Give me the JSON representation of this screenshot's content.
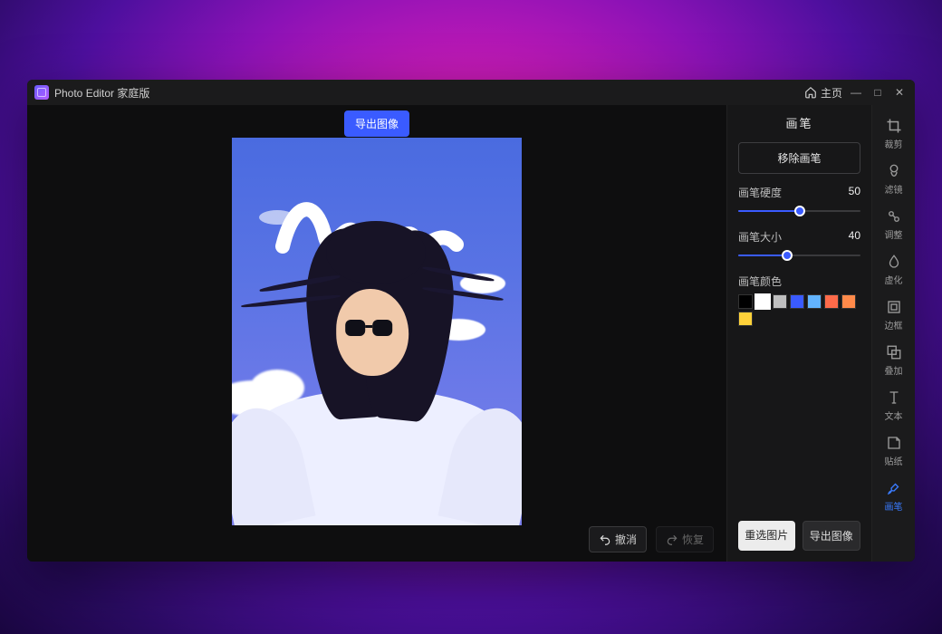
{
  "app": {
    "title": "Photo Editor 家庭版"
  },
  "titlebar": {
    "home": "主页"
  },
  "canvas": {
    "export_top": "导出图像",
    "undo": "撤消",
    "redo": "恢复"
  },
  "panel": {
    "title": "画笔",
    "remove": "移除画笔",
    "hardness": {
      "label": "画笔硬度",
      "value": 50,
      "min": 0,
      "max": 100
    },
    "size": {
      "label": "画笔大小",
      "value": 40,
      "min": 0,
      "max": 100
    },
    "color_label": "画笔颜色",
    "colors": [
      {
        "hex": "#000000",
        "selected": false
      },
      {
        "hex": "#ffffff",
        "selected": true
      },
      {
        "hex": "#bfbfbf",
        "selected": false
      },
      {
        "hex": "#3a5bff",
        "selected": false
      },
      {
        "hex": "#63b4ff",
        "selected": false
      },
      {
        "hex": "#ff6b4a",
        "selected": false
      },
      {
        "hex": "#ff8a4a",
        "selected": false
      },
      {
        "hex": "#ffd23a",
        "selected": false
      }
    ],
    "footer": {
      "repick": "重选图片",
      "export": "导出图像"
    }
  },
  "tools": [
    {
      "id": "crop",
      "label": "裁剪",
      "active": false
    },
    {
      "id": "filter",
      "label": "滤镜",
      "active": false
    },
    {
      "id": "adjust",
      "label": "调整",
      "active": false
    },
    {
      "id": "blur",
      "label": "虚化",
      "active": false
    },
    {
      "id": "frame",
      "label": "边框",
      "active": false
    },
    {
      "id": "overlay",
      "label": "叠加",
      "active": false
    },
    {
      "id": "text",
      "label": "文本",
      "active": false
    },
    {
      "id": "sticker",
      "label": "贴纸",
      "active": false
    },
    {
      "id": "brush",
      "label": "画笔",
      "active": true
    }
  ]
}
